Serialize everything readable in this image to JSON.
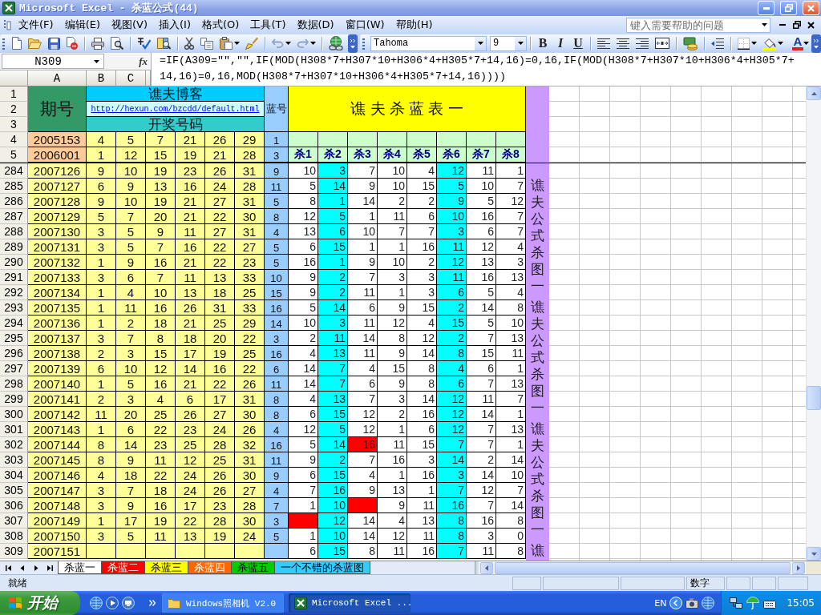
{
  "window": {
    "title": "Microsoft Excel - 杀蓝公式(44)"
  },
  "menu": [
    "文件(F)",
    "编辑(E)",
    "视图(V)",
    "插入(I)",
    "格式(O)",
    "工具(T)",
    "数据(D)",
    "窗口(W)",
    "帮助(H)"
  ],
  "help_search": {
    "placeholder": "键入需要帮助的问题"
  },
  "format_toolbar": {
    "font": "Tahoma",
    "size": "9",
    "bold": "B",
    "italic": "I",
    "underline": "U",
    "font_color": "A"
  },
  "formula_bar": {
    "name_box": "N309",
    "fx": "fx",
    "formula": "=IF(A309=\"\",\"\",IF(MOD(H308*7+H307*10+H306*4+H305*7+14,16)=0,16,IF(MOD(H308*7+H307*10+H306*4+H305*7+14,16)=0,16,MOD(H308*7+H307*10+H306*4+H305*7+14,16))))"
  },
  "column_headers": [
    "A",
    "B",
    "C"
  ],
  "header": {
    "row_numbers": [
      "1",
      "2",
      "3"
    ],
    "issue_label": "期号",
    "blog_title": "谯夫博客",
    "blog_link": "http://hexun.com/bzcdd/default.html",
    "draw_label": "开奖号码",
    "blue_label": "蓝号",
    "table_title": "谯 夫 杀 蓝 表 一"
  },
  "seed_rows": [
    {
      "kind": "plain",
      "row": "4",
      "issue": "2005153",
      "numbers": [
        "4",
        "5",
        "7",
        "21",
        "26",
        "29"
      ],
      "blue": "1"
    },
    {
      "kind": "labels",
      "row": "5",
      "issue": "2006001",
      "numbers": [
        "1",
        "12",
        "15",
        "19",
        "21",
        "28"
      ],
      "blue": "3"
    }
  ],
  "kill_columns": [
    {
      "label": "杀1",
      "shaded": false
    },
    {
      "label": "杀2",
      "shaded": true
    },
    {
      "label": "杀3",
      "shaded": false
    },
    {
      "label": "杀4",
      "shaded": false
    },
    {
      "label": "杀5",
      "shaded": false
    },
    {
      "label": "杀6",
      "shaded": true
    },
    {
      "label": "杀7",
      "shaded": false
    },
    {
      "label": "杀8",
      "shaded": false
    }
  ],
  "rows": [
    {
      "row": "284",
      "issue": "2007126",
      "numbers": [
        "9",
        "10",
        "19",
        "23",
        "26",
        "31"
      ],
      "blue": "9",
      "kills": [
        {
          "value": "10",
          "hit": false
        },
        {
          "value": "3",
          "hit": false
        },
        {
          "value": "7",
          "hit": false
        },
        {
          "value": "10",
          "hit": false
        },
        {
          "value": "4",
          "hit": false
        },
        {
          "value": "12",
          "hit": false
        },
        {
          "value": "11",
          "hit": false
        },
        {
          "value": "1",
          "hit": false
        }
      ]
    },
    {
      "row": "285",
      "issue": "2007127",
      "numbers": [
        "6",
        "9",
        "13",
        "16",
        "24",
        "28"
      ],
      "blue": "11",
      "kills": [
        {
          "value": "5",
          "hit": false
        },
        {
          "value": "14",
          "hit": false
        },
        {
          "value": "9",
          "hit": false
        },
        {
          "value": "10",
          "hit": false
        },
        {
          "value": "15",
          "hit": false
        },
        {
          "value": "5",
          "hit": false
        },
        {
          "value": "10",
          "hit": false
        },
        {
          "value": "7",
          "hit": false
        }
      ]
    },
    {
      "row": "286",
      "issue": "2007128",
      "numbers": [
        "9",
        "10",
        "19",
        "21",
        "27",
        "31"
      ],
      "blue": "5",
      "kills": [
        {
          "value": "8",
          "hit": false
        },
        {
          "value": "1",
          "hit": false
        },
        {
          "value": "14",
          "hit": false
        },
        {
          "value": "2",
          "hit": false
        },
        {
          "value": "2",
          "hit": false
        },
        {
          "value": "9",
          "hit": false
        },
        {
          "value": "5",
          "hit": false
        },
        {
          "value": "12",
          "hit": false
        }
      ]
    },
    {
      "row": "287",
      "issue": "2007129",
      "numbers": [
        "5",
        "7",
        "20",
        "21",
        "22",
        "30"
      ],
      "blue": "8",
      "kills": [
        {
          "value": "12",
          "hit": false
        },
        {
          "value": "5",
          "hit": false
        },
        {
          "value": "1",
          "hit": false
        },
        {
          "value": "11",
          "hit": false
        },
        {
          "value": "6",
          "hit": false
        },
        {
          "value": "10",
          "hit": false
        },
        {
          "value": "16",
          "hit": false
        },
        {
          "value": "7",
          "hit": false
        }
      ]
    },
    {
      "row": "288",
      "issue": "2007130",
      "numbers": [
        "3",
        "5",
        "9",
        "11",
        "27",
        "31"
      ],
      "blue": "4",
      "kills": [
        {
          "value": "13",
          "hit": false
        },
        {
          "value": "6",
          "hit": false
        },
        {
          "value": "10",
          "hit": false
        },
        {
          "value": "7",
          "hit": false
        },
        {
          "value": "7",
          "hit": false
        },
        {
          "value": "3",
          "hit": false
        },
        {
          "value": "6",
          "hit": false
        },
        {
          "value": "7",
          "hit": false
        }
      ]
    },
    {
      "row": "289",
      "issue": "2007131",
      "numbers": [
        "3",
        "5",
        "7",
        "16",
        "22",
        "27"
      ],
      "blue": "5",
      "kills": [
        {
          "value": "6",
          "hit": false
        },
        {
          "value": "15",
          "hit": false
        },
        {
          "value": "1",
          "hit": false
        },
        {
          "value": "1",
          "hit": false
        },
        {
          "value": "16",
          "hit": false
        },
        {
          "value": "11",
          "hit": false
        },
        {
          "value": "12",
          "hit": false
        },
        {
          "value": "4",
          "hit": false
        }
      ]
    },
    {
      "row": "290",
      "issue": "2007132",
      "numbers": [
        "1",
        "9",
        "16",
        "21",
        "22",
        "23"
      ],
      "blue": "5",
      "kills": [
        {
          "value": "16",
          "hit": false
        },
        {
          "value": "1",
          "hit": false
        },
        {
          "value": "9",
          "hit": false
        },
        {
          "value": "10",
          "hit": false
        },
        {
          "value": "2",
          "hit": false
        },
        {
          "value": "12",
          "hit": false
        },
        {
          "value": "13",
          "hit": false
        },
        {
          "value": "3",
          "hit": false
        }
      ]
    },
    {
      "row": "291",
      "issue": "2007133",
      "numbers": [
        "3",
        "6",
        "7",
        "11",
        "13",
        "33"
      ],
      "blue": "10",
      "kills": [
        {
          "value": "9",
          "hit": false
        },
        {
          "value": "2",
          "hit": false
        },
        {
          "value": "7",
          "hit": false
        },
        {
          "value": "3",
          "hit": false
        },
        {
          "value": "3",
          "hit": false
        },
        {
          "value": "11",
          "hit": false
        },
        {
          "value": "16",
          "hit": false
        },
        {
          "value": "13",
          "hit": false
        }
      ]
    },
    {
      "row": "292",
      "issue": "2007134",
      "numbers": [
        "1",
        "4",
        "10",
        "13",
        "18",
        "25"
      ],
      "blue": "15",
      "kills": [
        {
          "value": "9",
          "hit": false
        },
        {
          "value": "2",
          "hit": false
        },
        {
          "value": "11",
          "hit": false
        },
        {
          "value": "1",
          "hit": false
        },
        {
          "value": "3",
          "hit": false
        },
        {
          "value": "6",
          "hit": false
        },
        {
          "value": "5",
          "hit": false
        },
        {
          "value": "4",
          "hit": false
        }
      ]
    },
    {
      "row": "293",
      "issue": "2007135",
      "numbers": [
        "1",
        "11",
        "16",
        "26",
        "31",
        "33"
      ],
      "blue": "16",
      "kills": [
        {
          "value": "5",
          "hit": false
        },
        {
          "value": "14",
          "hit": false
        },
        {
          "value": "6",
          "hit": false
        },
        {
          "value": "9",
          "hit": false
        },
        {
          "value": "15",
          "hit": false
        },
        {
          "value": "2",
          "hit": false
        },
        {
          "value": "14",
          "hit": false
        },
        {
          "value": "8",
          "hit": false
        }
      ]
    },
    {
      "row": "294",
      "issue": "2007136",
      "numbers": [
        "1",
        "2",
        "18",
        "21",
        "25",
        "29"
      ],
      "blue": "14",
      "kills": [
        {
          "value": "10",
          "hit": false
        },
        {
          "value": "3",
          "hit": false
        },
        {
          "value": "11",
          "hit": false
        },
        {
          "value": "12",
          "hit": false
        },
        {
          "value": "4",
          "hit": false
        },
        {
          "value": "15",
          "hit": false
        },
        {
          "value": "5",
          "hit": false
        },
        {
          "value": "10",
          "hit": false
        }
      ]
    },
    {
      "row": "295",
      "issue": "2007137",
      "numbers": [
        "3",
        "7",
        "8",
        "18",
        "20",
        "22"
      ],
      "blue": "3",
      "kills": [
        {
          "value": "2",
          "hit": false
        },
        {
          "value": "11",
          "hit": false
        },
        {
          "value": "14",
          "hit": false
        },
        {
          "value": "8",
          "hit": false
        },
        {
          "value": "12",
          "hit": false
        },
        {
          "value": "2",
          "hit": false
        },
        {
          "value": "7",
          "hit": false
        },
        {
          "value": "13",
          "hit": false
        }
      ]
    },
    {
      "row": "296",
      "issue": "2007138",
      "numbers": [
        "2",
        "3",
        "15",
        "17",
        "19",
        "25"
      ],
      "blue": "16",
      "kills": [
        {
          "value": "4",
          "hit": false
        },
        {
          "value": "13",
          "hit": false
        },
        {
          "value": "11",
          "hit": false
        },
        {
          "value": "9",
          "hit": false
        },
        {
          "value": "14",
          "hit": false
        },
        {
          "value": "8",
          "hit": false
        },
        {
          "value": "15",
          "hit": false
        },
        {
          "value": "11",
          "hit": false
        }
      ]
    },
    {
      "row": "297",
      "issue": "2007139",
      "numbers": [
        "6",
        "10",
        "12",
        "14",
        "16",
        "22"
      ],
      "blue": "6",
      "kills": [
        {
          "value": "14",
          "hit": false
        },
        {
          "value": "7",
          "hit": false
        },
        {
          "value": "4",
          "hit": false
        },
        {
          "value": "15",
          "hit": false
        },
        {
          "value": "8",
          "hit": false
        },
        {
          "value": "4",
          "hit": false
        },
        {
          "value": "6",
          "hit": false
        },
        {
          "value": "1",
          "hit": false
        }
      ]
    },
    {
      "row": "298",
      "issue": "2007140",
      "numbers": [
        "1",
        "5",
        "16",
        "21",
        "22",
        "26"
      ],
      "blue": "11",
      "kills": [
        {
          "value": "14",
          "hit": false
        },
        {
          "value": "7",
          "hit": false
        },
        {
          "value": "6",
          "hit": false
        },
        {
          "value": "9",
          "hit": false
        },
        {
          "value": "8",
          "hit": false
        },
        {
          "value": "6",
          "hit": false
        },
        {
          "value": "7",
          "hit": false
        },
        {
          "value": "13",
          "hit": false
        }
      ]
    },
    {
      "row": "299",
      "issue": "2007141",
      "numbers": [
        "2",
        "3",
        "4",
        "6",
        "17",
        "31"
      ],
      "blue": "8",
      "kills": [
        {
          "value": "4",
          "hit": false
        },
        {
          "value": "13",
          "hit": false
        },
        {
          "value": "7",
          "hit": false
        },
        {
          "value": "3",
          "hit": false
        },
        {
          "value": "14",
          "hit": false
        },
        {
          "value": "12",
          "hit": false
        },
        {
          "value": "11",
          "hit": false
        },
        {
          "value": "7",
          "hit": false
        }
      ]
    },
    {
      "row": "300",
      "issue": "2007142",
      "numbers": [
        "11",
        "20",
        "25",
        "26",
        "27",
        "30"
      ],
      "blue": "8",
      "kills": [
        {
          "value": "6",
          "hit": false
        },
        {
          "value": "15",
          "hit": false
        },
        {
          "value": "12",
          "hit": false
        },
        {
          "value": "2",
          "hit": false
        },
        {
          "value": "16",
          "hit": false
        },
        {
          "value": "12",
          "hit": false
        },
        {
          "value": "14",
          "hit": false
        },
        {
          "value": "1",
          "hit": false
        }
      ]
    },
    {
      "row": "301",
      "issue": "2007143",
      "numbers": [
        "1",
        "6",
        "22",
        "23",
        "24",
        "26"
      ],
      "blue": "4",
      "kills": [
        {
          "value": "12",
          "hit": false
        },
        {
          "value": "5",
          "hit": false
        },
        {
          "value": "12",
          "hit": false
        },
        {
          "value": "1",
          "hit": false
        },
        {
          "value": "6",
          "hit": false
        },
        {
          "value": "12",
          "hit": false
        },
        {
          "value": "7",
          "hit": false
        },
        {
          "value": "13",
          "hit": false
        }
      ]
    },
    {
      "row": "302",
      "issue": "2007144",
      "numbers": [
        "8",
        "14",
        "23",
        "25",
        "28",
        "32"
      ],
      "blue": "16",
      "kills": [
        {
          "value": "5",
          "hit": false
        },
        {
          "value": "14",
          "hit": false
        },
        {
          "value": "16",
          "hit": true
        },
        {
          "value": "11",
          "hit": false
        },
        {
          "value": "15",
          "hit": false
        },
        {
          "value": "7",
          "hit": false
        },
        {
          "value": "7",
          "hit": false
        },
        {
          "value": "1",
          "hit": false
        }
      ]
    },
    {
      "row": "303",
      "issue": "2007145",
      "numbers": [
        "8",
        "9",
        "11",
        "12",
        "25",
        "31"
      ],
      "blue": "11",
      "kills": [
        {
          "value": "9",
          "hit": false
        },
        {
          "value": "2",
          "hit": false
        },
        {
          "value": "7",
          "hit": false
        },
        {
          "value": "16",
          "hit": false
        },
        {
          "value": "3",
          "hit": false
        },
        {
          "value": "14",
          "hit": false
        },
        {
          "value": "2",
          "hit": false
        },
        {
          "value": "14",
          "hit": false
        }
      ]
    },
    {
      "row": "304",
      "issue": "2007146",
      "numbers": [
        "4",
        "18",
        "22",
        "24",
        "26",
        "30"
      ],
      "blue": "9",
      "kills": [
        {
          "value": "6",
          "hit": false
        },
        {
          "value": "15",
          "hit": false
        },
        {
          "value": "4",
          "hit": false
        },
        {
          "value": "1",
          "hit": false
        },
        {
          "value": "16",
          "hit": false
        },
        {
          "value": "3",
          "hit": false
        },
        {
          "value": "14",
          "hit": false
        },
        {
          "value": "10",
          "hit": false
        }
      ]
    },
    {
      "row": "305",
      "issue": "2007147",
      "numbers": [
        "3",
        "7",
        "18",
        "24",
        "26",
        "27"
      ],
      "blue": "4",
      "kills": [
        {
          "value": "7",
          "hit": false
        },
        {
          "value": "16",
          "hit": false
        },
        {
          "value": "9",
          "hit": false
        },
        {
          "value": "13",
          "hit": false
        },
        {
          "value": "1",
          "hit": false
        },
        {
          "value": "7",
          "hit": false
        },
        {
          "value": "12",
          "hit": false
        },
        {
          "value": "7",
          "hit": false
        }
      ]
    },
    {
      "row": "306",
      "issue": "2007148",
      "numbers": [
        "3",
        "9",
        "16",
        "17",
        "23",
        "28"
      ],
      "blue": "7",
      "kills": [
        {
          "value": "1",
          "hit": false
        },
        {
          "value": "10",
          "hit": false
        },
        {
          "hit": true
        },
        {
          "value": "9",
          "hit": false
        },
        {
          "value": "11",
          "hit": false
        },
        {
          "value": "16",
          "hit": false
        },
        {
          "value": "7",
          "hit": false
        },
        {
          "value": "14",
          "hit": false
        }
      ]
    },
    {
      "row": "307",
      "issue": "2007149",
      "numbers": [
        "1",
        "17",
        "19",
        "22",
        "28",
        "30"
      ],
      "blue": "3",
      "kills": [
        {
          "hit": true
        },
        {
          "value": "12",
          "hit": false
        },
        {
          "value": "14",
          "hit": false
        },
        {
          "value": "4",
          "hit": false
        },
        {
          "value": "13",
          "hit": false
        },
        {
          "value": "8",
          "hit": false
        },
        {
          "value": "16",
          "hit": false
        },
        {
          "value": "8",
          "hit": false
        }
      ]
    },
    {
      "row": "308",
      "issue": "2007150",
      "numbers": [
        "3",
        "5",
        "11",
        "13",
        "19",
        "24"
      ],
      "blue": "5",
      "kills": [
        {
          "value": "1",
          "hit": false
        },
        {
          "value": "10",
          "hit": false
        },
        {
          "value": "14",
          "hit": false
        },
        {
          "value": "12",
          "hit": false
        },
        {
          "value": "11",
          "hit": false
        },
        {
          "value": "8",
          "hit": false
        },
        {
          "value": "3",
          "hit": false
        },
        {
          "value": "0",
          "hit": false
        }
      ]
    },
    {
      "row": "309",
      "issue": "2007151",
      "kills": [
        {
          "value": "6",
          "hit": false
        },
        {
          "value": "15",
          "hit": false
        },
        {
          "value": "8",
          "hit": false
        },
        {
          "value": "11",
          "hit": false
        },
        {
          "value": "16",
          "hit": false
        },
        {
          "value": "7",
          "hit": false
        },
        {
          "value": "11",
          "hit": false
        },
        {
          "value": "8",
          "hit": false
        }
      ]
    }
  ],
  "side_label": [
    "谯夫公式杀图一",
    "谯夫公式杀图一",
    "谯夫公式杀图一",
    "谯"
  ],
  "sheet_tabs": [
    {
      "label": "杀蓝一",
      "selected": true
    },
    {
      "label": "杀蓝二",
      "selected": false,
      "color": "#ff0000"
    },
    {
      "label": "杀蓝三",
      "selected": false,
      "color": "#ffff00"
    },
    {
      "label": "杀蓝四",
      "selected": false,
      "color": "#ff6600"
    },
    {
      "label": "杀蓝五",
      "selected": false,
      "color": "#00cc00"
    },
    {
      "label": "一个不错的杀蓝图",
      "selected": false,
      "color": "#33ccff"
    }
  ],
  "status_bar": {
    "status": "就绪",
    "mode": "数字"
  },
  "taskbar": {
    "start": "开始",
    "tasks": [
      {
        "label": "Windows照相机 V2.0",
        "selected": false
      },
      {
        "label": "Microsoft Excel ...",
        "selected": true
      }
    ],
    "language": "EN",
    "clock": "15:05"
  }
}
